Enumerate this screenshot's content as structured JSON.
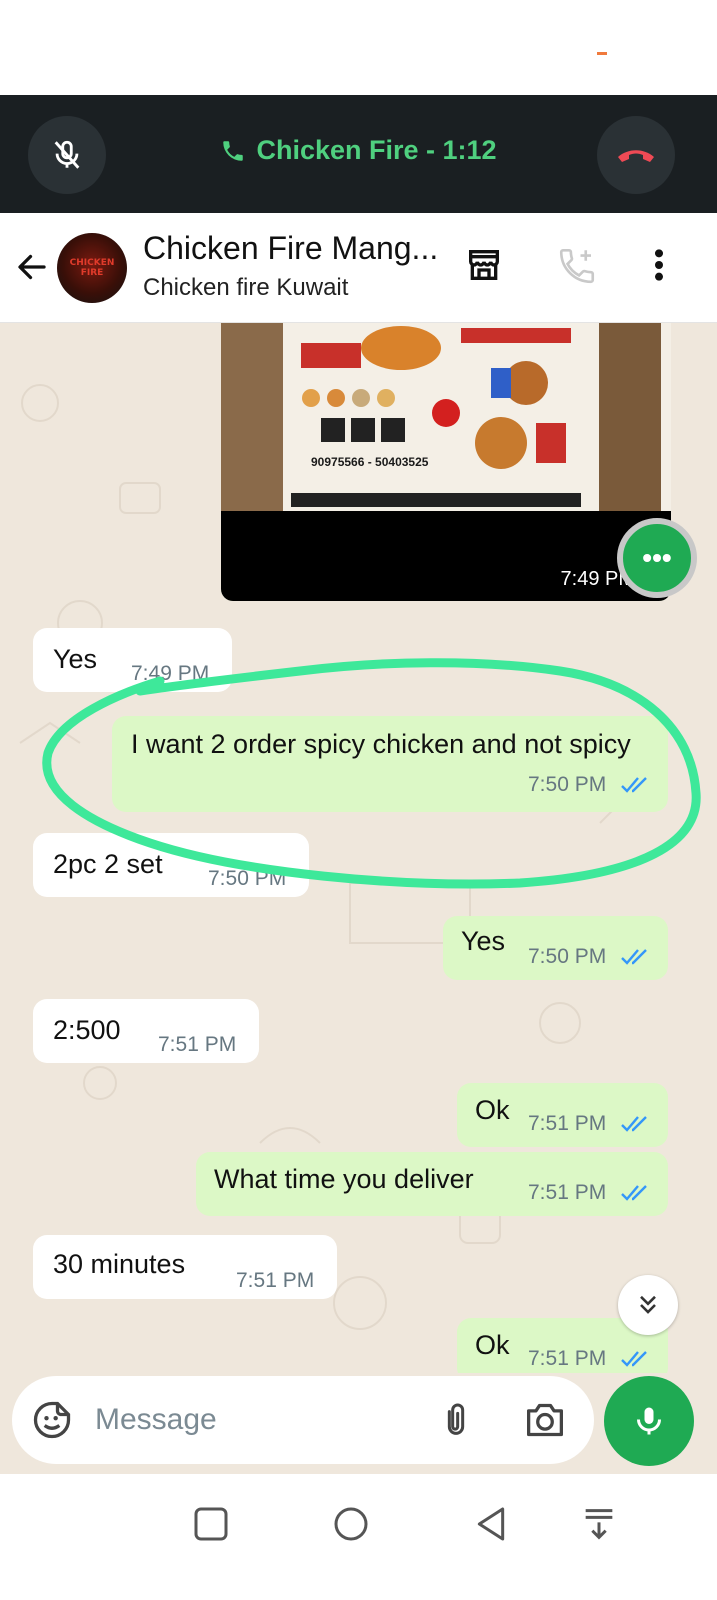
{
  "colors": {
    "call_green": "#4fd07f",
    "outgoing_bubble": "#dcf8c6",
    "incoming_bubble": "#ffffff",
    "read_tick": "#3497f9",
    "annotation": "#3ee89a",
    "brand_green": "#1faa53"
  },
  "call": {
    "title": "Chicken Fire - 1:12"
  },
  "header": {
    "name": "Chicken Fire Mang...",
    "subtitle": "Chicken fire Kuwait",
    "avatar_text": "CHICKEN FIRE"
  },
  "image_message": {
    "time": "7:49 PM",
    "flyer_phone": "90975566 - 50403525"
  },
  "messages": [
    {
      "dir": "in",
      "text": "Yes",
      "time": "7:49 PM"
    },
    {
      "dir": "out",
      "text": "I want 2 order spicy chicken and not spicy",
      "time": "7:50 PM",
      "status": "read"
    },
    {
      "dir": "in",
      "text": "2pc 2 set",
      "time": "7:50 PM"
    },
    {
      "dir": "out",
      "text": "Yes",
      "time": "7:50 PM",
      "status": "read"
    },
    {
      "dir": "in",
      "text": "2:500",
      "time": "7:51 PM"
    },
    {
      "dir": "out",
      "text": "Ok",
      "time": "7:51 PM",
      "status": "read"
    },
    {
      "dir": "out",
      "text": "What time you deliver",
      "time": "7:51 PM",
      "status": "read"
    },
    {
      "dir": "in",
      "text": "30 minutes",
      "time": "7:51 PM"
    },
    {
      "dir": "out",
      "text": "Ok",
      "time": "7:51 PM",
      "status": "read"
    }
  ],
  "input": {
    "placeholder": "Message"
  }
}
